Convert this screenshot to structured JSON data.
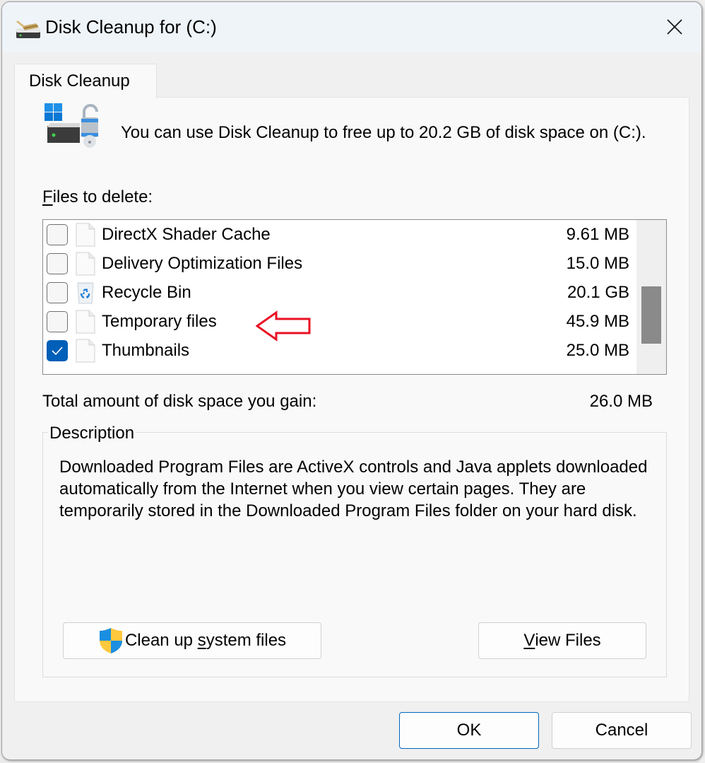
{
  "window": {
    "title": "Disk Cleanup for  (C:)",
    "app_icon": "disk-cleanup-broom-icon",
    "close_icon": "close-icon"
  },
  "tabs": [
    {
      "label": "Disk Cleanup",
      "selected": true
    }
  ],
  "intro": {
    "icon": "drive-unlock-icon",
    "text": "You can use Disk Cleanup to free up to 20.2 GB of disk space on  (C:)."
  },
  "files_to_delete": {
    "label_accel": "F",
    "label_rest": "iles to delete:",
    "items": [
      {
        "name": "DirectX Shader Cache",
        "size": "9.61 MB",
        "checked": false,
        "icon": "file-icon"
      },
      {
        "name": "Delivery Optimization Files",
        "size": "15.0 MB",
        "checked": false,
        "icon": "file-icon"
      },
      {
        "name": "Recycle Bin",
        "size": "20.1 GB",
        "checked": false,
        "icon": "recycle-bin-icon"
      },
      {
        "name": "Temporary files",
        "size": "45.9 MB",
        "checked": false,
        "icon": "file-icon",
        "annotated": true
      },
      {
        "name": "Thumbnails",
        "size": "25.0 MB",
        "checked": true,
        "icon": "file-icon"
      }
    ],
    "annotation": {
      "type": "red-arrow-left",
      "color": "#e81123",
      "target": "Temporary files"
    }
  },
  "total": {
    "label": "Total amount of disk space you gain:",
    "value": "26.0 MB"
  },
  "description": {
    "legend": "Description",
    "text": "Downloaded Program Files are ActiveX controls and Java applets downloaded automatically from the Internet when you view certain pages. They are temporarily stored in the Downloaded Program Files folder on your hard disk."
  },
  "buttons": {
    "cleanup_pre": "Clean up ",
    "cleanup_accel": "s",
    "cleanup_post": "ystem files",
    "view_accel": "V",
    "view_rest": "iew Files",
    "ok": "OK",
    "cancel": "Cancel"
  },
  "colors": {
    "accent": "#005fb8",
    "ok_border": "#0067c0",
    "annotation": "#e81123"
  }
}
